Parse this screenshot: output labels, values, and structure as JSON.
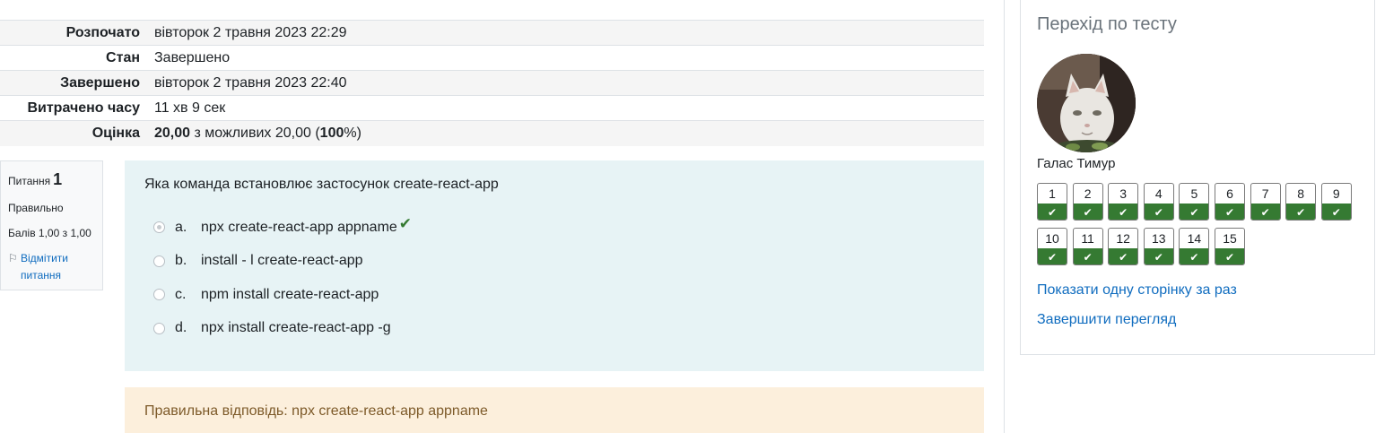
{
  "summary": [
    {
      "label": "Розпочато",
      "value": "вівторок 2 травня 2023 22:29"
    },
    {
      "label": "Стан",
      "value": "Завершено"
    },
    {
      "label": "Завершено",
      "value": "вівторок 2 травня 2023 22:40"
    },
    {
      "label": "Витрачено часу",
      "value": "11 хв 9 сек"
    },
    {
      "label": "Оцінка",
      "grade": "20,00",
      "grade_mid": "з можливих 20,00 (",
      "percent": "100",
      "grade_end": "%)"
    }
  ],
  "question_info": {
    "label": "Питання",
    "number": "1",
    "state": "Правильно",
    "mark": "Балів 1,00 з 1,00",
    "flag_label": "Відмітити питання",
    "flag_icon": "flag-icon"
  },
  "question": {
    "text": "Яка команда встановлює застосунок create-react-app",
    "options": [
      {
        "letter": "a.",
        "text": "npx create-react-app appname",
        "selected": true,
        "correct_icon": "check-icon"
      },
      {
        "letter": "b.",
        "text": "install - l create-react-app",
        "selected": false
      },
      {
        "letter": "c.",
        "text": "npm install create-react-app",
        "selected": false
      },
      {
        "letter": "d.",
        "text": "npx install create-react-app -g",
        "selected": false
      }
    ]
  },
  "feedback": {
    "text": "Правильна відповідь: npx create-react-app appname"
  },
  "navigation": {
    "title": "Перехід по тесту",
    "user_name": "Галас Тимур",
    "questions": [
      "1",
      "2",
      "3",
      "4",
      "5",
      "6",
      "7",
      "8",
      "9",
      "10",
      "11",
      "12",
      "13",
      "14",
      "15"
    ],
    "state_icon": "check-icon",
    "links": {
      "show_one_page": "Показати одну сторінку за раз",
      "finish_review": "Завершити перегляд"
    }
  },
  "colors": {
    "question_bg": "#e7f3f5",
    "feedback_bg": "#fcefdc",
    "correct": "#357a32",
    "link": "#0f6cbf"
  }
}
